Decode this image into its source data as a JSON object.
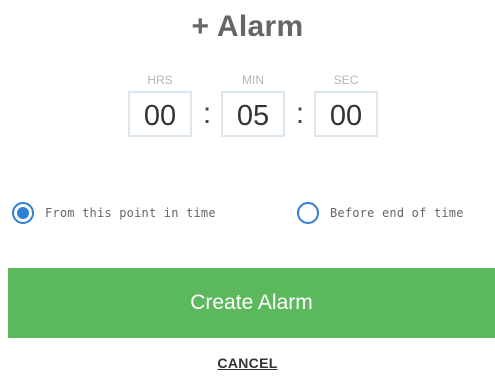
{
  "dialog": {
    "title": "+ Alarm"
  },
  "time": {
    "hours": {
      "caption": "HRS",
      "value": "00"
    },
    "minutes": {
      "caption": "MIN",
      "value": "05"
    },
    "seconds": {
      "caption": "SEC",
      "value": "00"
    },
    "separator": ":"
  },
  "options": [
    {
      "label": "From this point in time",
      "selected": true
    },
    {
      "label": "Before end of time",
      "selected": false
    }
  ],
  "actions": {
    "create_label": "Create Alarm",
    "cancel_label": "CANCEL"
  },
  "colors": {
    "accent": "#2f7fd4",
    "create_button": "#5cb85c",
    "title": "#666666"
  }
}
